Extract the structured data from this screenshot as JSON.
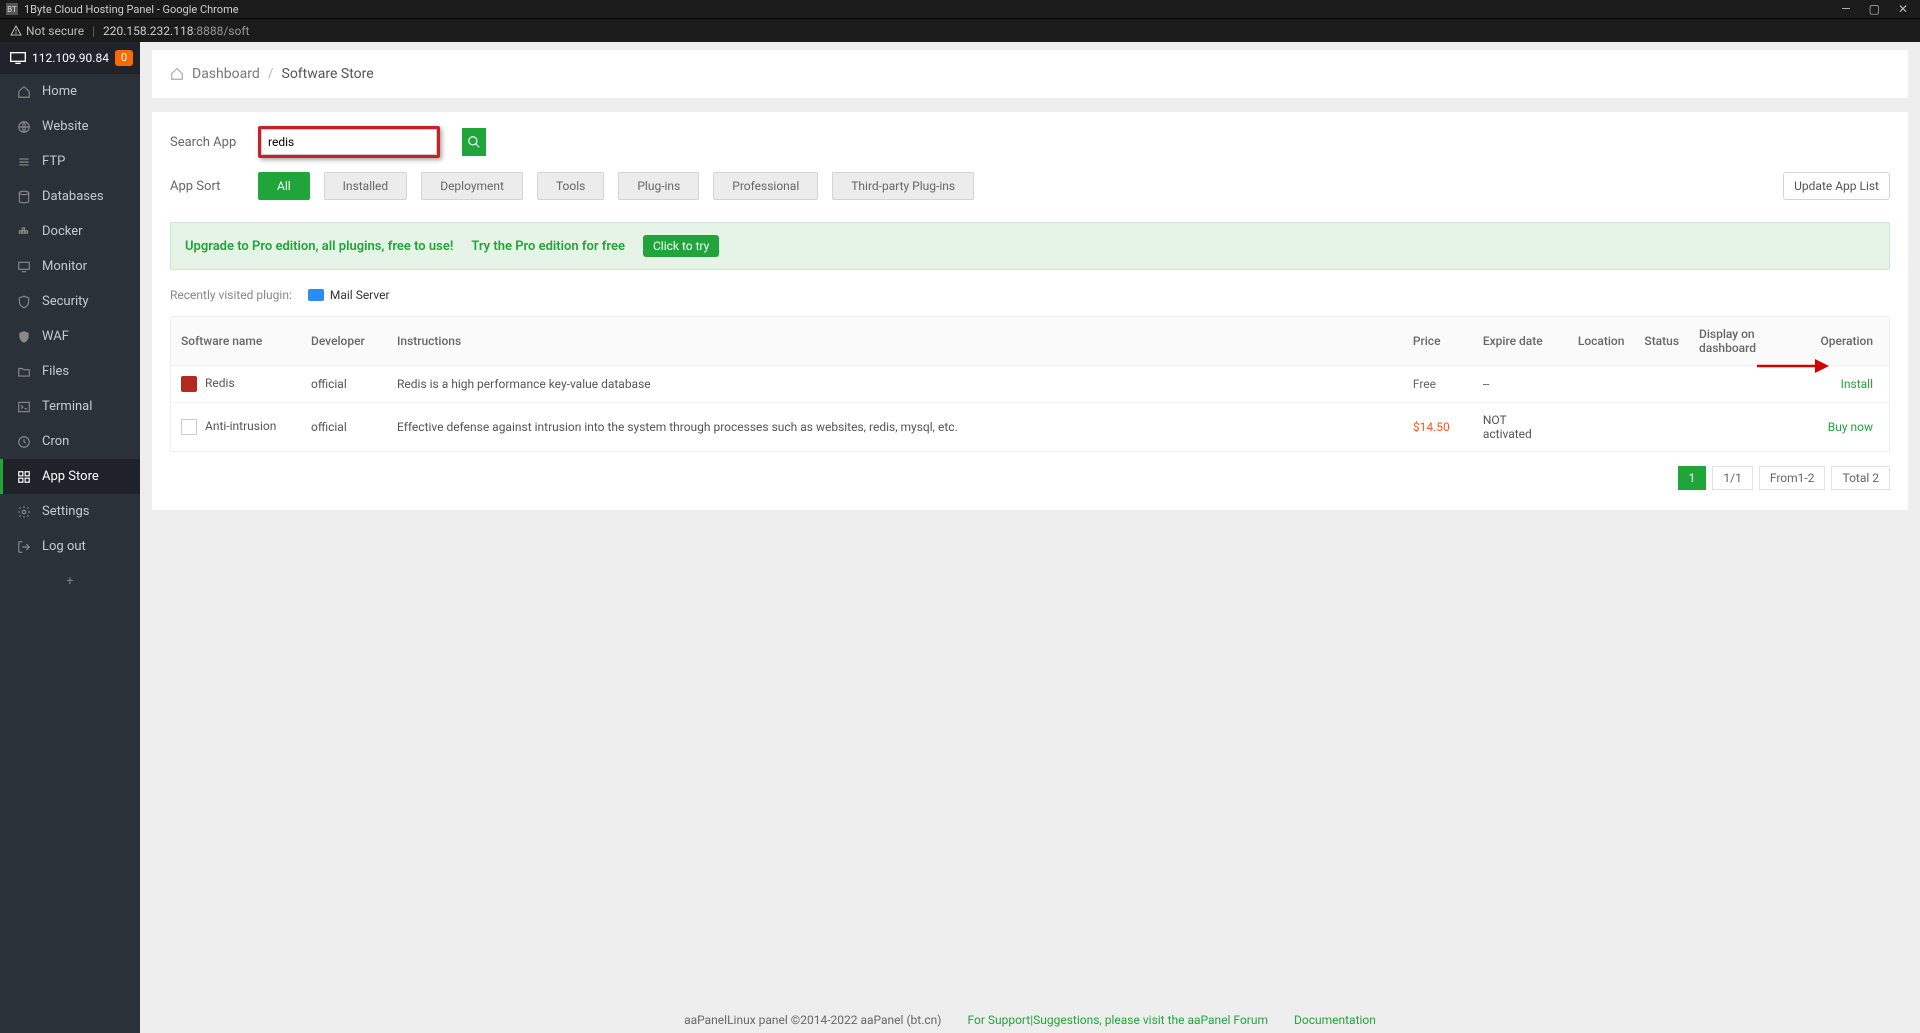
{
  "browser": {
    "favicon": "BT",
    "title": "1Byte Cloud Hosting Panel - Google Chrome",
    "security_label": "Not secure",
    "url_host": "220.158.232.118",
    "url_port": ":8888",
    "url_path": "/soft"
  },
  "sidebar": {
    "server_ip": "112.109.90.84",
    "badge_count": "0",
    "items": [
      {
        "label": "Home"
      },
      {
        "label": "Website"
      },
      {
        "label": "FTP"
      },
      {
        "label": "Databases"
      },
      {
        "label": "Docker"
      },
      {
        "label": "Monitor"
      },
      {
        "label": "Security"
      },
      {
        "label": "WAF"
      },
      {
        "label": "Files"
      },
      {
        "label": "Terminal"
      },
      {
        "label": "Cron"
      },
      {
        "label": "App Store"
      },
      {
        "label": "Settings"
      },
      {
        "label": "Log out"
      }
    ]
  },
  "breadcrumb": {
    "root": "Dashboard",
    "current": "Software Store"
  },
  "search": {
    "label": "Search App",
    "value": "redis"
  },
  "sort": {
    "label": "App Sort",
    "pills": [
      "All",
      "Installed",
      "Deployment",
      "Tools",
      "Plug-ins",
      "Professional",
      "Third-party Plug-ins"
    ],
    "update_btn": "Update App List"
  },
  "upgrade": {
    "line1": "Upgrade to Pro edition, all plugins, free to use!",
    "line2": "Try the Pro edition for free",
    "button": "Click to try"
  },
  "recent": {
    "label": "Recently visited plugin:",
    "item": "Mail Server"
  },
  "table": {
    "headers": {
      "name": "Software name",
      "developer": "Developer",
      "instructions": "Instructions",
      "price": "Price",
      "expire": "Expire date",
      "location": "Location",
      "status": "Status",
      "display": "Display on dashboard",
      "operation": "Operation"
    },
    "rows": [
      {
        "name": "Redis",
        "developer": "official",
        "instructions": "Redis is a high performance key-value database",
        "price": "Free",
        "price_class": "price-free",
        "expire": "--",
        "operation": "Install",
        "icon": "redis"
      },
      {
        "name": "Anti-intrusion",
        "developer": "official",
        "instructions": "Effective defense against intrusion into the system through processes such as websites, redis, mysql, etc.",
        "price": "$14.50",
        "price_class": "price-paid",
        "expire": "NOT activated",
        "operation": "Buy now",
        "icon": "anti"
      }
    ]
  },
  "pagination": {
    "current": "1",
    "pages": "1/1",
    "range": "From1-2",
    "total": "Total 2"
  },
  "footer": {
    "copyright": "aaPanelLinux panel ©2014-2022 aaPanel (bt.cn)",
    "support": "For Support|Suggestions, please visit the aaPanel Forum",
    "docs": "Documentation"
  }
}
